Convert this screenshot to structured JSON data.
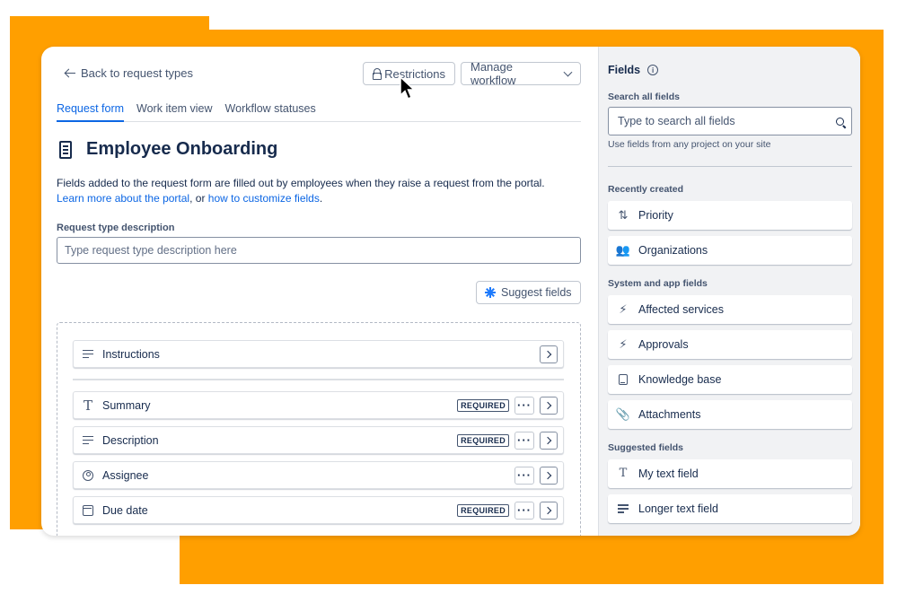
{
  "header": {
    "back_label": "Back to request types",
    "restrictions_label": "Restrictions",
    "workflow_label": "Manage workflow"
  },
  "tabs": [
    {
      "label": "Request form",
      "active": true
    },
    {
      "label": "Work item view",
      "active": false
    },
    {
      "label": "Workflow statuses",
      "active": false
    }
  ],
  "page": {
    "title": "Employee Onboarding",
    "description_text": "Fields added to the request form are filled out by employees when they raise a request from the portal.",
    "link1": "Learn more about the portal",
    "link_sep": ", or ",
    "link2": "how to customize fields",
    "link_end": ".",
    "description_label": "Request type description",
    "description_placeholder": "Type request type description here",
    "suggest_label": "Suggest fields"
  },
  "form_fields": [
    {
      "name": "Instructions",
      "icon": "lines-icon",
      "required": false,
      "more": false
    },
    {
      "name": "Summary",
      "icon": "text-icon",
      "required": true,
      "more": true
    },
    {
      "name": "Description",
      "icon": "lines-icon",
      "required": true,
      "more": true
    },
    {
      "name": "Assignee",
      "icon": "person-icon",
      "required": false,
      "more": true
    },
    {
      "name": "Due date",
      "icon": "calendar-icon",
      "required": true,
      "more": true
    }
  ],
  "required_badge": "REQUIRED",
  "more_glyph": "···",
  "sidebar": {
    "title": "Fields",
    "search_label": "Search all fields",
    "search_placeholder": "Type to search all fields",
    "hint": "Use fields from any project on your site",
    "recent_label": "Recently created",
    "recent": [
      {
        "name": "Priority",
        "icon": "sort-icon"
      },
      {
        "name": "Organizations",
        "icon": "people-icon"
      }
    ],
    "system_label": "System and app fields",
    "system": [
      {
        "name": "Affected services",
        "icon": "bolt-icon"
      },
      {
        "name": "Approvals",
        "icon": "bolt-icon"
      },
      {
        "name": "Knowledge base",
        "icon": "book-icon"
      },
      {
        "name": "Attachments",
        "icon": "paperclip-icon"
      }
    ],
    "suggested_label": "Suggested fields",
    "suggested": [
      {
        "name": "My text field",
        "icon": "text-icon"
      },
      {
        "name": "Longer text field",
        "icon": "lines-icon"
      }
    ]
  },
  "colors": {
    "background_accent": "#FF9F00",
    "link": "#0C66E4",
    "text": "#172B4D"
  }
}
